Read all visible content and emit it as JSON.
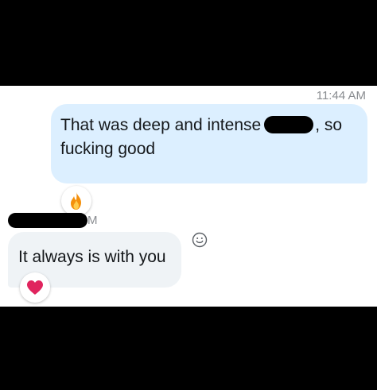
{
  "timestamp": "11:44 AM",
  "sent_message": {
    "line1_before": "That was deep and intense",
    "line1_after": ", so",
    "line2": "fucking good",
    "reaction": "fire-emoji"
  },
  "received_message": {
    "sender_suffix": "M",
    "text": "It always is with you",
    "reaction": "heart-emoji"
  },
  "colors": {
    "sent_bubble": "#dcefff",
    "received_bubble": "#eff3f6",
    "heart": "#e0245e",
    "muted_text": "#8a8d91"
  }
}
